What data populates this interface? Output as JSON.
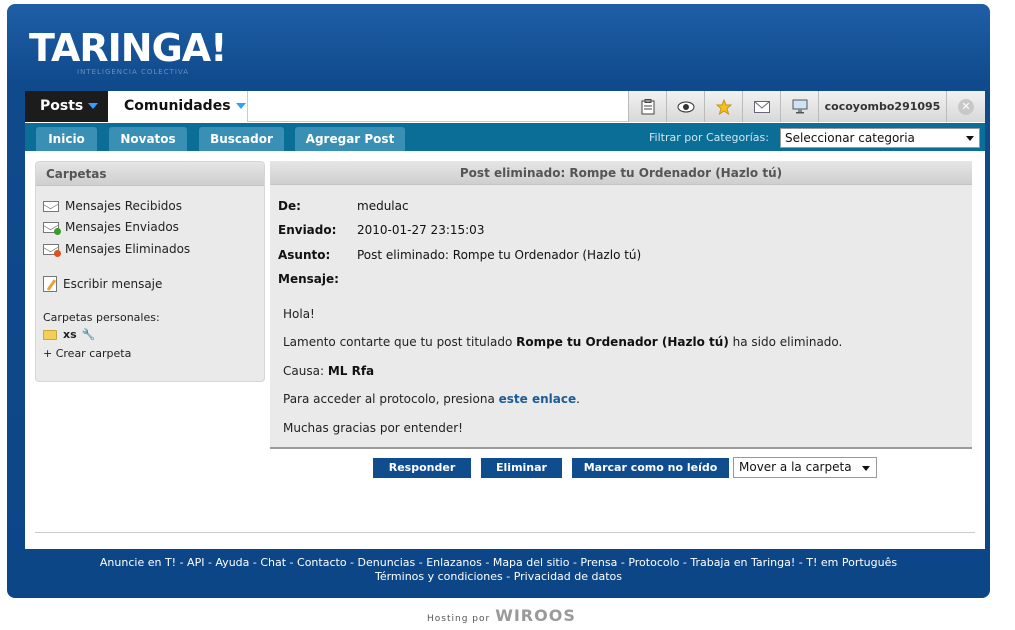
{
  "header": {
    "logo_text": "TARINGA!",
    "tagline": "INTELIGENCIA COLECTIVA"
  },
  "topbar": {
    "posts_tab": "Posts",
    "comunidades_tab": "Comunidades",
    "icons": [
      "clipboard-icon",
      "eye-icon",
      "star-icon",
      "mail-icon",
      "monitor-icon"
    ],
    "username": "cocoyombo291095",
    "close_glyph": "✕"
  },
  "subnav": {
    "items": [
      "Inicio",
      "Novatos",
      "Buscador",
      "Agregar Post"
    ],
    "filter_label": "Filtrar por Categorías:",
    "filter_value": "Seleccionar categoria"
  },
  "sidebar": {
    "title": "Carpetas",
    "links": {
      "received": "Mensajes Recibidos",
      "sent": "Mensajes Enviados",
      "deleted": "Mensajes Eliminados",
      "compose": "Escribir mensaje"
    },
    "personal_label": "Carpetas personales:",
    "folders": [
      "xs"
    ],
    "create_folder": "+ Crear carpeta"
  },
  "message": {
    "title": "Post eliminado: Rompe tu Ordenador (Hazlo tú)",
    "labels": {
      "from": "De:",
      "sent": "Enviado:",
      "subject": "Asunto:",
      "body": "Mensaje:"
    },
    "from": "medulac",
    "sent": "2010-01-27 23:15:03",
    "subject": "Post eliminado: Rompe tu Ordenador (Hazlo tú)",
    "body": {
      "greeting": "Hola!",
      "line1_pre": "Lamento contarte que tu post titulado",
      "line1_bold": "Rompe tu Ordenador (Hazlo tú)",
      "line1_post": "ha sido eliminado.",
      "cause_label": "Causa:",
      "cause_value": "ML Rfa",
      "protocol_pre": "Para acceder al protocolo, presiona",
      "protocol_link": "este enlace",
      "protocol_post": ".",
      "thanks": "Muchas gracias por entender!"
    }
  },
  "actions": {
    "reply": "Responder",
    "delete": "Eliminar",
    "mark_unread": "Marcar como no leído",
    "move_to_folder": "Mover a la carpeta"
  },
  "footer": {
    "line1": "Anuncie en T! - API - Ayuda - Chat - Contacto - Denuncias - Enlazanos - Mapa del sitio - Prensa - Protocolo - Trabaja en Taringa! - T! em Português",
    "line2": "Términos y condiciones - Privacidad de datos",
    "hosting_label": "Hosting por",
    "hosting_brand": "WIROOS"
  },
  "colors": {
    "frame_blue": "#0f4a8c",
    "subnav_teal": "#0b6e96",
    "button_blue": "#0f4d8f",
    "link_blue": "#1d5b95"
  }
}
